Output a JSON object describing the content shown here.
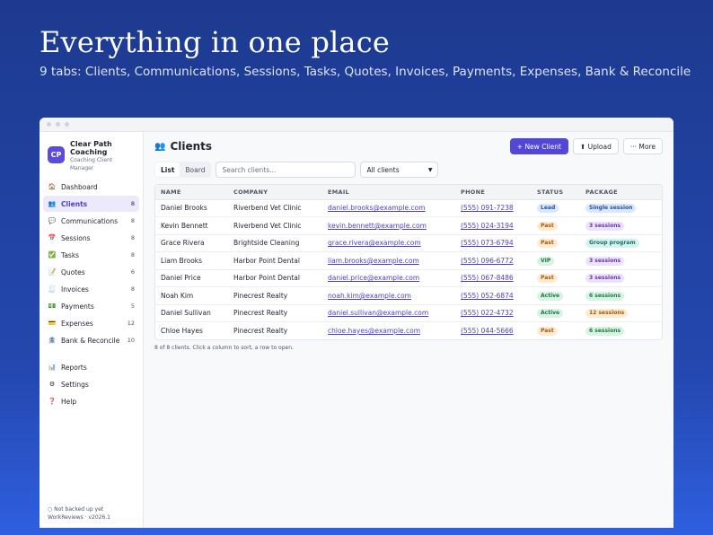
{
  "hero": {
    "title": "Everything in one place",
    "subtitle": "9 tabs: Clients, Communications, Sessions, Tasks, Quotes, Invoices, Payments, Expenses, Bank & Reconcile"
  },
  "brand": {
    "logo_text": "CP",
    "name_line1": "Clear Path",
    "name_line2": "Coaching",
    "tagline_line1": "Coaching Client",
    "tagline_line2": "Manager"
  },
  "sidebar": {
    "items": [
      {
        "id": "dashboard",
        "label": "Dashboard",
        "icon": "home-icon",
        "glyph": "🏠",
        "count": ""
      },
      {
        "id": "clients",
        "label": "Clients",
        "icon": "people-icon",
        "glyph": "👥",
        "count": "8",
        "active": true
      },
      {
        "id": "communications",
        "label": "Communications",
        "icon": "chat-icon",
        "glyph": "💬",
        "count": "8"
      },
      {
        "id": "sessions",
        "label": "Sessions",
        "icon": "calendar-icon",
        "glyph": "📅",
        "count": "8"
      },
      {
        "id": "tasks",
        "label": "Tasks",
        "icon": "check-icon",
        "glyph": "✅",
        "count": "8"
      },
      {
        "id": "quotes",
        "label": "Quotes",
        "icon": "memo-icon",
        "glyph": "📝",
        "count": "6"
      },
      {
        "id": "invoices",
        "label": "Invoices",
        "icon": "receipt-icon",
        "glyph": "🧾",
        "count": "8"
      },
      {
        "id": "payments",
        "label": "Payments",
        "icon": "money-icon",
        "glyph": "💵",
        "count": "5"
      },
      {
        "id": "expenses",
        "label": "Expenses",
        "icon": "card-icon",
        "glyph": "💳",
        "count": "12"
      },
      {
        "id": "bank",
        "label": "Bank & Reconcile",
        "icon": "bank-icon",
        "glyph": "🏦",
        "count": "10"
      }
    ],
    "secondary": [
      {
        "id": "reports",
        "label": "Reports",
        "icon": "chart-icon",
        "glyph": "📊"
      },
      {
        "id": "settings",
        "label": "Settings",
        "icon": "gear-icon",
        "glyph": "⚙"
      },
      {
        "id": "help",
        "label": "Help",
        "icon": "question-icon",
        "glyph": "❓"
      }
    ],
    "footer_line1": "○ Not backed up yet",
    "footer_line2": "WorkReviews · v2026.1"
  },
  "page": {
    "title": "Clients",
    "icon_glyph": "👥"
  },
  "actions": {
    "new_client": "+ New Client",
    "upload": "⬆ Upload",
    "more": "··· More"
  },
  "toolbar": {
    "view_list": "List",
    "view_board": "Board",
    "search_placeholder": "Search clients...",
    "filter_value": "All clients"
  },
  "table": {
    "columns": [
      "NAME",
      "COMPANY",
      "EMAIL",
      "PHONE",
      "STATUS",
      "PACKAGE"
    ],
    "rows": [
      {
        "name": "Daniel Brooks",
        "company": "Riverbend Vet Clinic",
        "email": "daniel.brooks@example.com",
        "phone": "(555) 091-7238",
        "status": "Lead",
        "package": "Single session"
      },
      {
        "name": "Kevin Bennett",
        "company": "Riverbend Vet Clinic",
        "email": "kevin.bennett@example.com",
        "phone": "(555) 024-3194",
        "status": "Past",
        "package": "3 sessions"
      },
      {
        "name": "Grace Rivera",
        "company": "Brightside Cleaning",
        "email": "grace.rivera@example.com",
        "phone": "(555) 073-6794",
        "status": "Past",
        "package": "Group program"
      },
      {
        "name": "Liam Brooks",
        "company": "Harbor Point Dental",
        "email": "liam.brooks@example.com",
        "phone": "(555) 096-6772",
        "status": "VIP",
        "package": "3 sessions"
      },
      {
        "name": "Daniel Price",
        "company": "Harbor Point Dental",
        "email": "daniel.price@example.com",
        "phone": "(555) 067-8486",
        "status": "Past",
        "package": "3 sessions"
      },
      {
        "name": "Noah Kim",
        "company": "Pinecrest Realty",
        "email": "noah.kim@example.com",
        "phone": "(555) 052-6874",
        "status": "Active",
        "package": "6 sessions"
      },
      {
        "name": "Daniel Sullivan",
        "company": "Pinecrest Realty",
        "email": "daniel.sullivan@example.com",
        "phone": "(555) 022-4732",
        "status": "Active",
        "package": "12 sessions"
      },
      {
        "name": "Chloe Hayes",
        "company": "Pinecrest Realty",
        "email": "chloe.hayes@example.com",
        "phone": "(555) 044-5666",
        "status": "Past",
        "package": "6 sessions"
      }
    ],
    "footer": "8 of 8 clients. Click a column to sort, a row to open."
  },
  "colors": {
    "accent": "#5447d6",
    "status": {
      "Lead": {
        "bg": "#dbe7fb",
        "fg": "#2453a6"
      },
      "Past": {
        "bg": "#fdebd1",
        "fg": "#a5590a"
      },
      "VIP": {
        "bg": "#d8f3e3",
        "fg": "#1d7a45"
      },
      "Active": {
        "bg": "#d8f3e3",
        "fg": "#1d7a45"
      }
    },
    "package": {
      "Single session": {
        "bg": "#dbe7fb",
        "fg": "#2453a6"
      },
      "3 sessions": {
        "bg": "#ebe3fb",
        "fg": "#6a34b8"
      },
      "Group program": {
        "bg": "#d6f2ef",
        "fg": "#137367"
      },
      "6 sessions": {
        "bg": "#d8f3e3",
        "fg": "#1d7a45"
      },
      "12 sessions": {
        "bg": "#fdebd1",
        "fg": "#a5590a"
      }
    }
  }
}
